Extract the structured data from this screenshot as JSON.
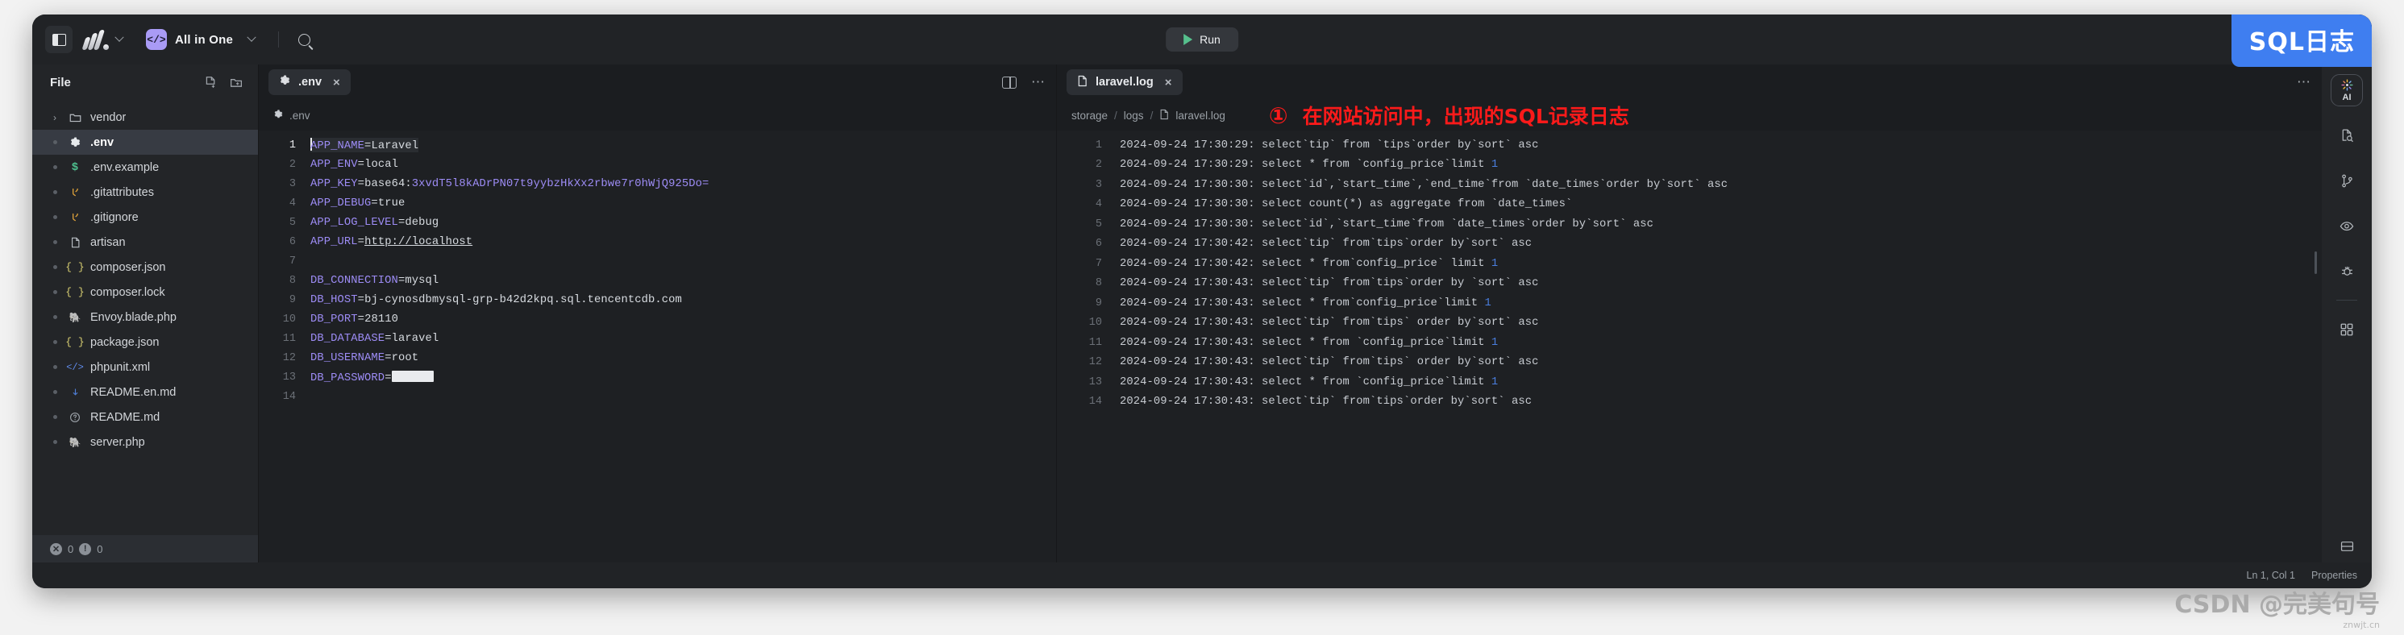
{
  "titlebar": {
    "panel_toggle": "toggle-panel",
    "project_name": "All in One",
    "run_label": "Run",
    "search": "search"
  },
  "overlay_badge": "SQL日志",
  "watermark": {
    "text": "CSDN @完美句号",
    "sub": "znwjt.cn"
  },
  "sidebar": {
    "title": "File",
    "items": [
      {
        "name": "vendor",
        "icon": "folder",
        "kind": "folder",
        "selected": false
      },
      {
        "name": ".env",
        "icon": "gear",
        "kind": "file",
        "selected": true
      },
      {
        "name": ".env.example",
        "icon": "dollar",
        "kind": "file",
        "selected": false
      },
      {
        "name": ".gitattributes",
        "icon": "git",
        "kind": "file",
        "selected": false
      },
      {
        "name": ".gitignore",
        "icon": "git",
        "kind": "file",
        "selected": false
      },
      {
        "name": "artisan",
        "icon": "file",
        "kind": "file",
        "selected": false
      },
      {
        "name": "composer.json",
        "icon": "braces",
        "kind": "file",
        "selected": false
      },
      {
        "name": "composer.lock",
        "icon": "braces",
        "kind": "file",
        "selected": false
      },
      {
        "name": "Envoy.blade.php",
        "icon": "php",
        "kind": "file",
        "selected": false
      },
      {
        "name": "package.json",
        "icon": "braces",
        "kind": "file",
        "selected": false
      },
      {
        "name": "phpunit.xml",
        "icon": "code",
        "kind": "file",
        "selected": false
      },
      {
        "name": "README.en.md",
        "icon": "down",
        "kind": "file",
        "selected": false
      },
      {
        "name": "README.md",
        "icon": "question",
        "kind": "file",
        "selected": false
      },
      {
        "name": "server.php",
        "icon": "php",
        "kind": "file",
        "selected": false
      }
    ],
    "status": {
      "errors": "0",
      "warnings": "0"
    }
  },
  "editor_left": {
    "tab": {
      "label": ".env",
      "icon": "gear-icon",
      "close": "×"
    },
    "breadcrumb": ".env",
    "lines": [
      {
        "n": "1",
        "key": "APP_NAME",
        "sep": "=",
        "val": "Laravel",
        "active": true
      },
      {
        "n": "2",
        "key": "APP_ENV",
        "sep": "=",
        "val": "local",
        "active": false
      },
      {
        "n": "3",
        "key": "APP_KEY",
        "sep": "=",
        "val": "base64:3xvdT5l8kADrPN07t9yybzHkXx2rbwe7r0hWjQ925Do=",
        "active": false,
        "style": "key"
      },
      {
        "n": "4",
        "key": "APP_DEBUG",
        "sep": "=",
        "val": "true",
        "active": false
      },
      {
        "n": "5",
        "key": "APP_LOG_LEVEL",
        "sep": "=",
        "val": "debug",
        "active": false
      },
      {
        "n": "6",
        "key": "APP_URL",
        "sep": "=",
        "val": "http://localhost",
        "active": false,
        "style": "link"
      },
      {
        "n": "7",
        "key": "",
        "sep": "",
        "val": "",
        "active": false
      },
      {
        "n": "8",
        "key": "DB_CONNECTION",
        "sep": "=",
        "val": "mysql",
        "active": false
      },
      {
        "n": "9",
        "key": "DB_HOST",
        "sep": "=",
        "val": "bj-cynosdbmysql-grp-b42d2kpq.sql.tencentcdb.com",
        "active": false
      },
      {
        "n": "10",
        "key": "DB_PORT",
        "sep": "=",
        "val": "28110",
        "active": false
      },
      {
        "n": "11",
        "key": "DB_DATABASE",
        "sep": "=",
        "val": "laravel",
        "active": false
      },
      {
        "n": "12",
        "key": "DB_USERNAME",
        "sep": "=",
        "val": "root",
        "active": false
      },
      {
        "n": "13",
        "key": "DB_PASSWORD",
        "sep": "=",
        "val": "",
        "active": false,
        "style": "redacted"
      },
      {
        "n": "14",
        "key": "",
        "sep": "",
        "val": "",
        "active": false
      }
    ]
  },
  "editor_right": {
    "tab": {
      "label": "laravel.log",
      "icon": "file-icon",
      "close": "×"
    },
    "breadcrumb": [
      "storage",
      "logs",
      "laravel.log"
    ],
    "annotation": {
      "marker": "①",
      "text": "在网站访问中，出现的SQL记录日志"
    },
    "lines": [
      {
        "n": "1",
        "ts": "2024-09-24 17:30:29: ",
        "sql": "select`tip` from `tips`order by`sort` asc"
      },
      {
        "n": "2",
        "ts": "2024-09-24 17:30:29: ",
        "sql": "select * from `config_price`limit ",
        "num": "1"
      },
      {
        "n": "3",
        "ts": "2024-09-24 17:30:30: ",
        "sql": "select`id`,`start_time`,`end_time`from `date_times`order by`sort` asc"
      },
      {
        "n": "4",
        "ts": "2024-09-24 17:30:30: ",
        "sql": "select count(*) as aggregate from `date_times`"
      },
      {
        "n": "5",
        "ts": "2024-09-24 17:30:30: ",
        "sql": "select`id`,`start_time`from `date_times`order by`sort` asc"
      },
      {
        "n": "6",
        "ts": "2024-09-24 17:30:42: ",
        "sql": "select`tip` from`tips`order by`sort` asc"
      },
      {
        "n": "7",
        "ts": "2024-09-24 17:30:42: ",
        "sql": "select * from`config_price` limit ",
        "num": "1"
      },
      {
        "n": "8",
        "ts": "2024-09-24 17:30:43: ",
        "sql": "select`tip` from`tips`order by `sort` asc"
      },
      {
        "n": "9",
        "ts": "2024-09-24 17:30:43: ",
        "sql": "select * from`config_price`limit ",
        "num": "1"
      },
      {
        "n": "10",
        "ts": "2024-09-24 17:30:43: ",
        "sql": "select`tip` from`tips` order by`sort` asc"
      },
      {
        "n": "11",
        "ts": "2024-09-24 17:30:43: ",
        "sql": "select * from `config_price`limit ",
        "num": "1"
      },
      {
        "n": "12",
        "ts": "2024-09-24 17:30:43: ",
        "sql": "select`tip` from`tips` order by`sort` asc"
      },
      {
        "n": "13",
        "ts": "2024-09-24 17:30:43: ",
        "sql": "select * from `config_price`limit ",
        "num": "1"
      },
      {
        "n": "14",
        "ts": "2024-09-24 17:30:43: ",
        "sql": "select`tip` from`tips`order by`sort` asc"
      }
    ]
  },
  "rail": {
    "items": [
      {
        "name": "ai",
        "label": "AI"
      },
      {
        "name": "file-search",
        "label": ""
      },
      {
        "name": "git-branch",
        "label": ""
      },
      {
        "name": "preview-eye",
        "label": ""
      },
      {
        "name": "debug-bug",
        "label": ""
      },
      {
        "name": "extensions",
        "label": ""
      }
    ],
    "bottom": {
      "name": "layout-panel"
    }
  },
  "statusbar": {
    "position": "Ln 1, Col 1",
    "properties": "Properties"
  }
}
